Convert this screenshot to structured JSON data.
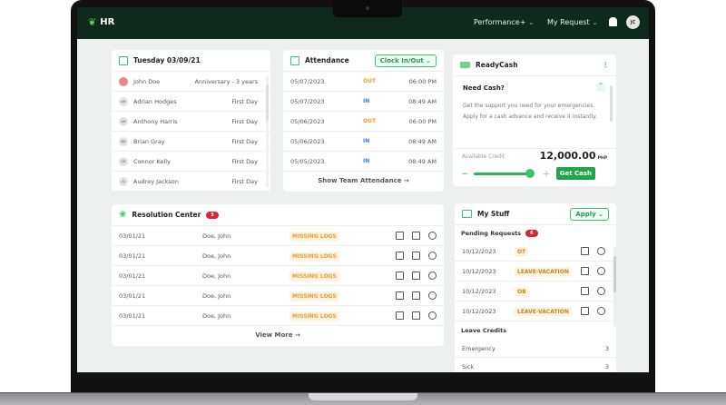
{
  "header": {
    "app": "HR",
    "nav": [
      "Performance+",
      "My Request"
    ],
    "avatar": "JC"
  },
  "calendar": {
    "title": "Tuesday 03/09/21",
    "rows": [
      {
        "initials": "",
        "name": "John Doe",
        "event": "Anniversary - 3 years"
      },
      {
        "initials": "AH",
        "name": "Adrian Hodges",
        "event": "First Day"
      },
      {
        "initials": "AH",
        "name": "Anthony Harris",
        "event": "First Day"
      },
      {
        "initials": "BG",
        "name": "Brian Gray",
        "event": "First Day"
      },
      {
        "initials": "CK",
        "name": "Connor Kelly",
        "event": "First Day"
      },
      {
        "initials": "AJ",
        "name": "Audrey Jackson",
        "event": "First Day"
      }
    ]
  },
  "attendance": {
    "title": "Attendance",
    "button": "Clock In/Out",
    "rows": [
      {
        "date": "05/07/2023",
        "type": "OUT",
        "time": "06:00 PM"
      },
      {
        "date": "05/07/2023",
        "type": "IN",
        "time": "08:49 AM"
      },
      {
        "date": "05/06/2023",
        "type": "OUT",
        "time": "06:00 PM"
      },
      {
        "date": "05/06/2023",
        "type": "IN",
        "time": "08:49 AM"
      },
      {
        "date": "05/05/2023",
        "type": "IN",
        "time": "08:49 AM"
      }
    ],
    "footer": "Show Team Attendance →"
  },
  "readycash": {
    "title": "ReadyCash",
    "heading": "Need Cash?",
    "text": "Get the support you need for your emergencies. Apply for a cash advance and receive it instantly.",
    "credit_label": "Available Credit",
    "amount": "12,000.00",
    "currency": "PHP",
    "button": "Get Cash",
    "slider_percent": 100
  },
  "resolution": {
    "title": "Resolution Center",
    "count": "5",
    "rows": [
      {
        "date": "03/01/21",
        "name": "Doe, John",
        "status": "MISSING LOGS"
      },
      {
        "date": "03/01/21",
        "name": "Doe, John",
        "status": "MISSING LOGS"
      },
      {
        "date": "03/01/21",
        "name": "Doe, John",
        "status": "MISSING LOGS"
      },
      {
        "date": "03/01/21",
        "name": "Doe, John",
        "status": "MISSING LOGS"
      },
      {
        "date": "03/01/21",
        "name": "Doe, John",
        "status": "MISSING LOGS"
      }
    ],
    "footer": "View More →"
  },
  "mystuff": {
    "title": "My Stuff",
    "button": "Apply",
    "pending_label": "Pending Requests",
    "pending_count": "6",
    "requests": [
      {
        "date": "10/12/2023",
        "type": "OT"
      },
      {
        "date": "10/12/2023",
        "type": "LEAVE-VACATION"
      },
      {
        "date": "10/12/2023",
        "type": "OB"
      },
      {
        "date": "10/12/2023",
        "type": "LEAVE-VACATION"
      }
    ],
    "credits_label": "Leave Credits",
    "credits": [
      {
        "name": "Emergency",
        "value": "3"
      },
      {
        "name": "Sick",
        "value": "3"
      }
    ]
  },
  "colors": {
    "header": "#0d2a1d",
    "accent": "#1e9c4b",
    "in": "#3b7fe0",
    "out": "#f39a2a"
  }
}
